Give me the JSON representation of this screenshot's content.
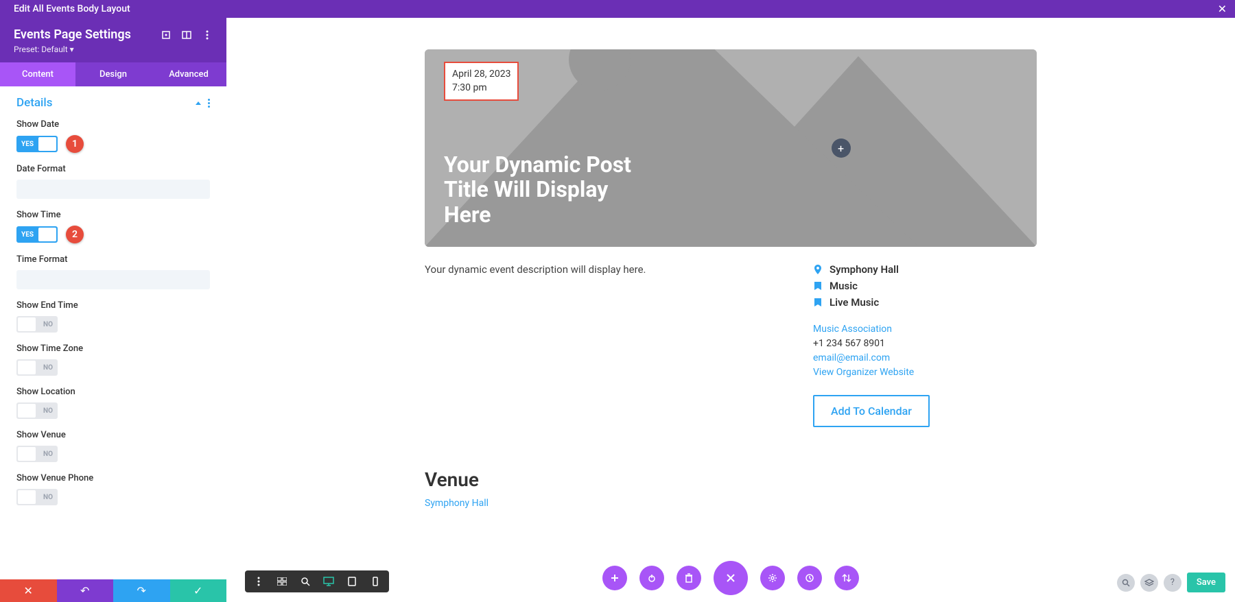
{
  "top_bar": {
    "title": "Edit All Events Body Layout"
  },
  "sidebar": {
    "title": "Events Page Settings",
    "preset": "Preset: Default",
    "tabs": [
      "Content",
      "Design",
      "Advanced"
    ],
    "active_tab": 0,
    "section_title": "Details",
    "fields": [
      {
        "label": "Show Date",
        "type": "toggle",
        "value": "YES",
        "badge": "1"
      },
      {
        "label": "Date Format",
        "type": "input",
        "value": ""
      },
      {
        "label": "Show Time",
        "type": "toggle",
        "value": "YES",
        "badge": "2"
      },
      {
        "label": "Time Format",
        "type": "input",
        "value": ""
      },
      {
        "label": "Show End Time",
        "type": "toggle",
        "value": "NO"
      },
      {
        "label": "Show Time Zone",
        "type": "toggle",
        "value": "NO"
      },
      {
        "label": "Show Location",
        "type": "toggle",
        "value": "NO"
      },
      {
        "label": "Show Venue",
        "type": "toggle",
        "value": "NO"
      },
      {
        "label": "Show Venue Phone",
        "type": "toggle",
        "value": "NO"
      }
    ]
  },
  "preview": {
    "date": "April 28, 2023",
    "time": "7:30 pm",
    "title": "Your Dynamic Post Title Will Display Here",
    "description": "Your dynamic event description will display here.",
    "meta": {
      "location": "Symphony Hall",
      "category1": "Music",
      "category2": "Live Music"
    },
    "organizer": {
      "name": "Music Association",
      "phone": "+1 234 567 8901",
      "email": "email@email.com",
      "website_label": "View Organizer Website"
    },
    "add_calendar": "Add To Calendar",
    "venue_heading": "Venue",
    "venue_name": "Symphony Hall"
  },
  "save_label": "Save"
}
